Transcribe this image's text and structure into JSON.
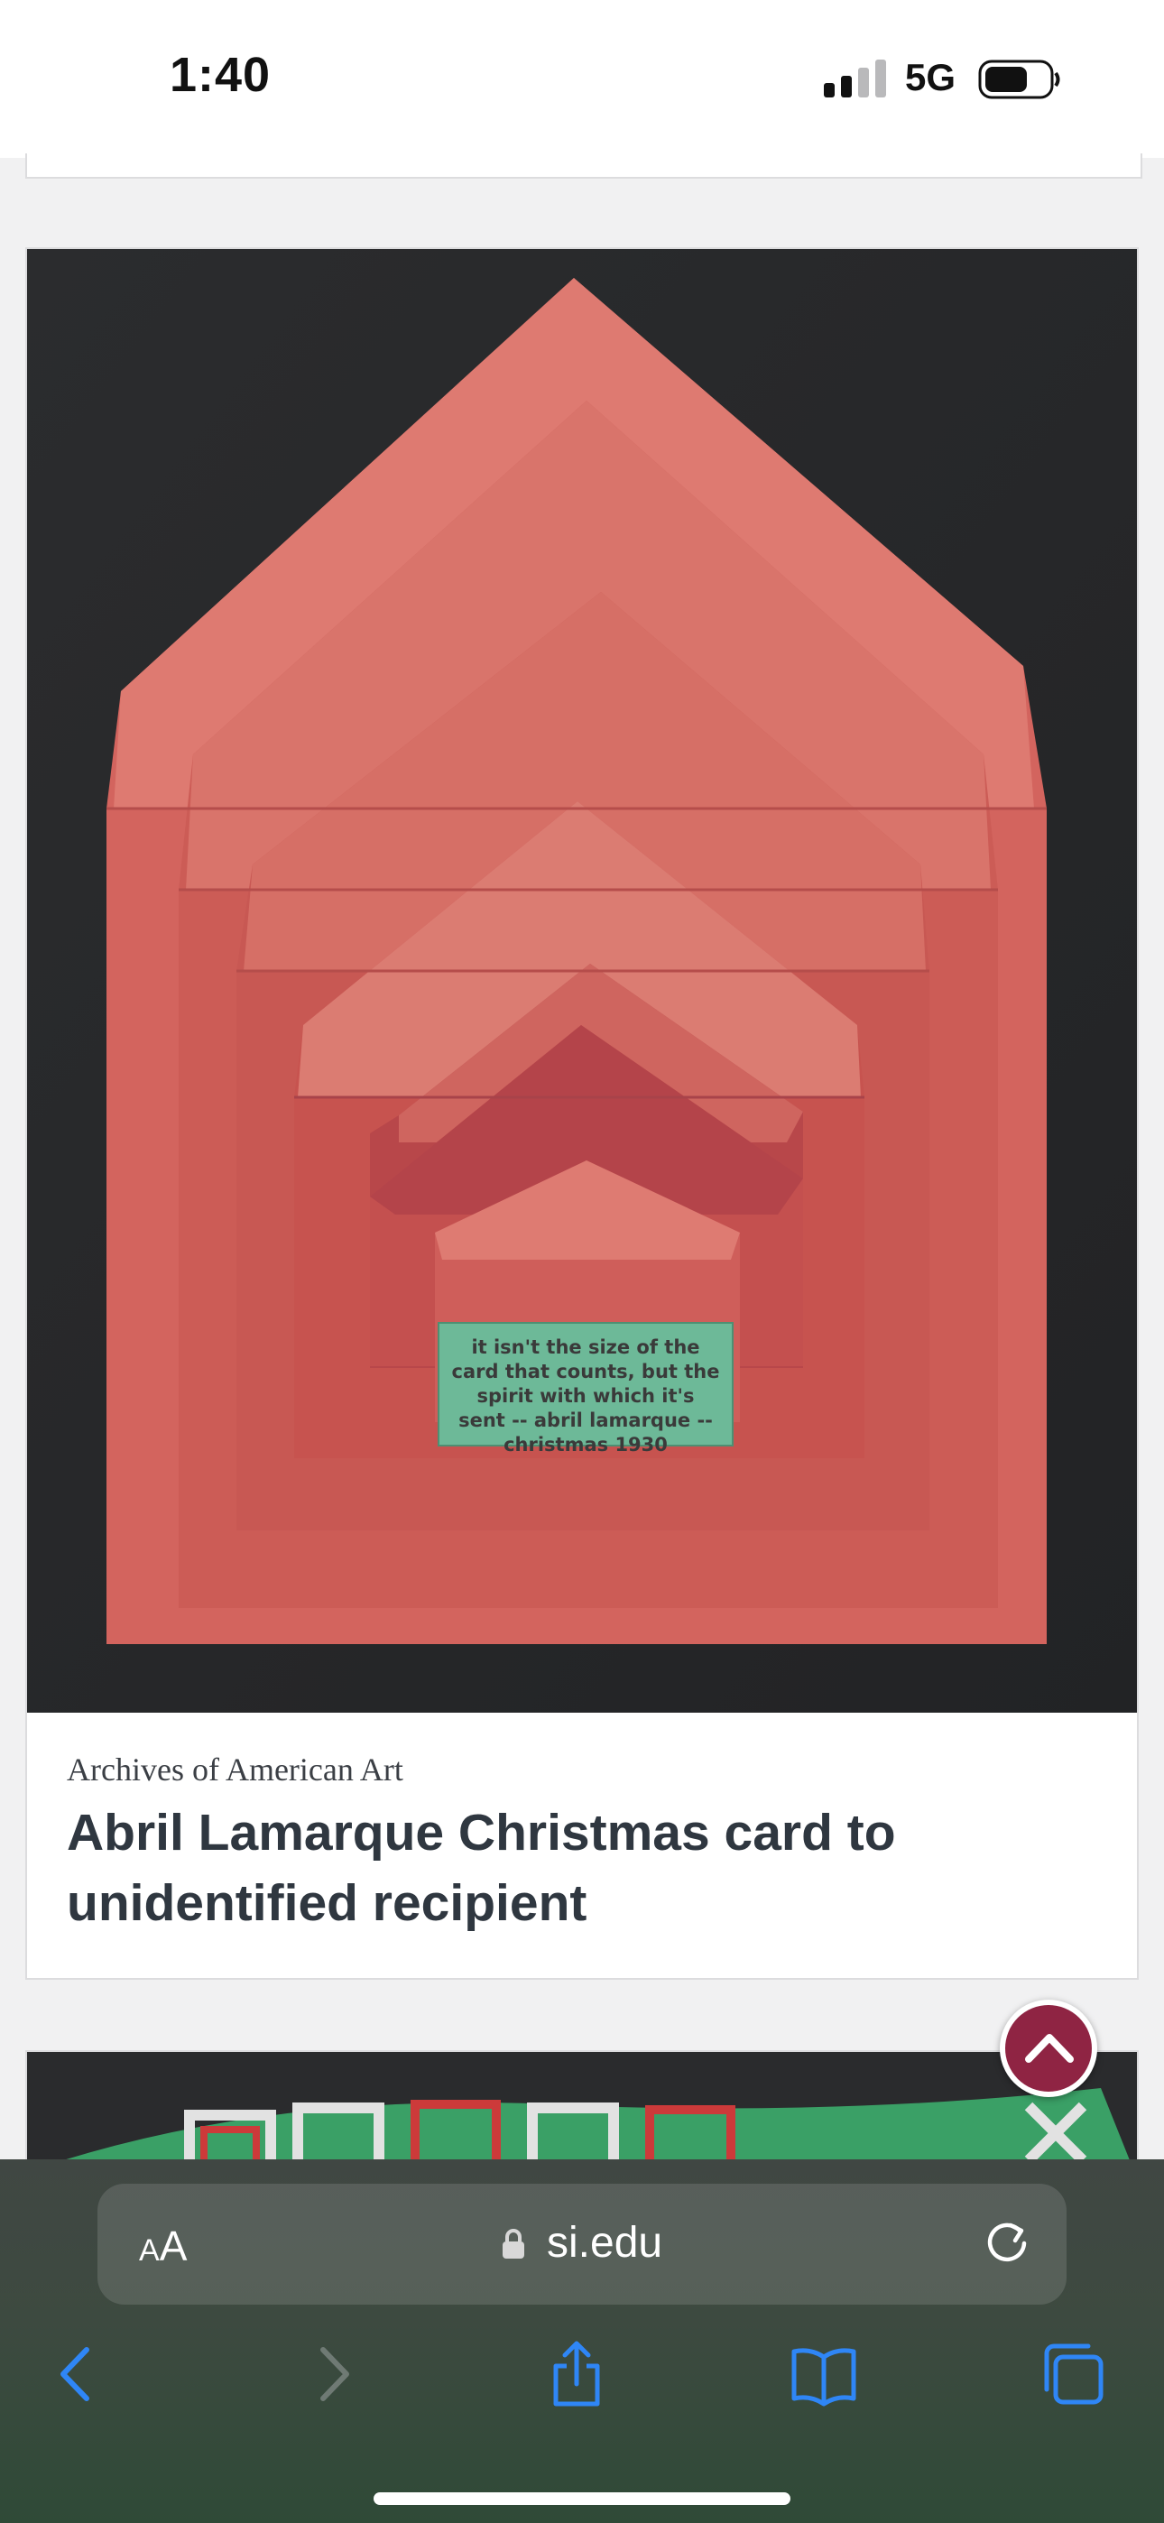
{
  "status_bar": {
    "time": "1:40",
    "network": "5G"
  },
  "card": {
    "image_alt": "Red nested pop-up card with green text panel",
    "image_inscription": [
      "it isn't the size of the",
      "card that counts, but the",
      "spirit with which it's",
      "sent -- abril lamarque --",
      "christmas 1930"
    ],
    "source": "Archives of American Art",
    "title": "Abril Lamarque Christmas card to unidentified recipient"
  },
  "browser": {
    "text_size_button": {
      "small": "A",
      "large": "A"
    },
    "url": "si.edu"
  },
  "colors": {
    "accent": "#8f2443",
    "card_red": "#d2645e",
    "panel_green": "#6db998",
    "page_bg": "#f1f1f2",
    "toolbar_icon": "#1f7cf3"
  },
  "icons": {
    "signal": "cellular-signal-icon",
    "battery": "battery-icon",
    "lock": "lock-icon",
    "reload": "reload-icon",
    "back": "back-arrow-icon",
    "forward": "forward-arrow-icon",
    "share": "share-icon",
    "bookmarks": "bookmarks-icon",
    "tabs": "tabs-icon",
    "back_to_top": "chevron-up-icon"
  }
}
